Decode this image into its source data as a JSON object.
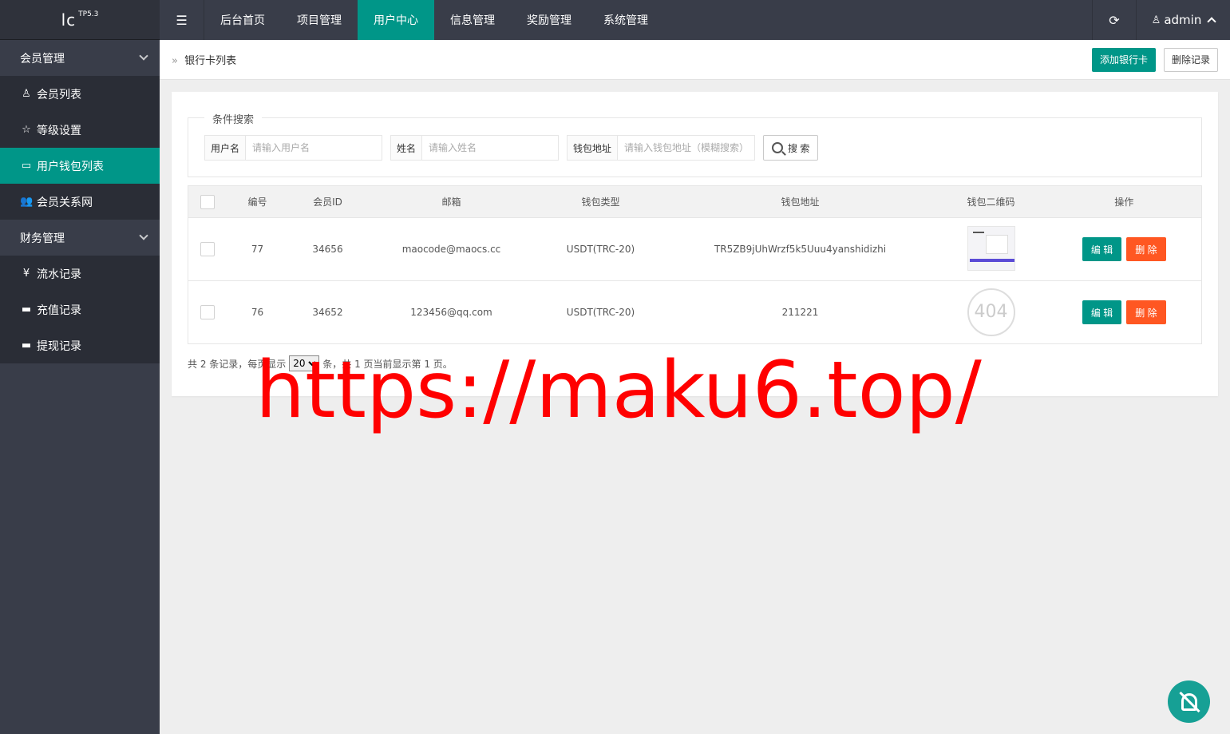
{
  "app": {
    "logo": "lc",
    "version": "TP5.3"
  },
  "sidebar": {
    "groups": [
      {
        "label": "会员管理",
        "items": [
          {
            "label": "会员列表",
            "icon": "user-icon",
            "glyph": "♙"
          },
          {
            "label": "等级设置",
            "icon": "star-icon",
            "glyph": "☆"
          },
          {
            "label": "用户钱包列表",
            "icon": "card-icon",
            "glyph": "▭"
          },
          {
            "label": "会员关系网",
            "icon": "users-icon",
            "glyph": "👥"
          }
        ]
      },
      {
        "label": "财务管理",
        "items": [
          {
            "label": "流水记录",
            "icon": "yen-icon",
            "glyph": "¥"
          },
          {
            "label": "充值记录",
            "icon": "paypal-icon",
            "glyph": "▬"
          },
          {
            "label": "提现记录",
            "icon": "wallet-icon",
            "glyph": "▬"
          }
        ]
      }
    ]
  },
  "topbar": {
    "menu_glyph": "☰",
    "tabs": [
      "后台首页",
      "项目管理",
      "用户中心",
      "信息管理",
      "奖励管理",
      "系统管理"
    ],
    "refresh_glyph": "⟳",
    "user_glyph": "♙",
    "username": "admin"
  },
  "breadcrumb": {
    "arrow": "»",
    "label": "银行卡列表"
  },
  "actions": {
    "add_label": "添加银行卡",
    "delete_log_label": "删除记录"
  },
  "search": {
    "legend": "条件搜索",
    "username_label": "用户名",
    "username_placeholder": "请输入用户名",
    "name_label": "姓名",
    "name_placeholder": "请输入姓名",
    "wallet_label": "钱包地址",
    "wallet_placeholder": "请输入钱包地址（模糊搜索）",
    "button_label": "搜 索"
  },
  "table": {
    "headers": [
      "编号",
      "会员ID",
      "邮箱",
      "钱包类型",
      "钱包地址",
      "钱包二维码",
      "操作"
    ],
    "rows": [
      {
        "id": "77",
        "member_id": "34656",
        "email": "maocode@maocs.cc",
        "type": "USDT(TRC-20)",
        "address": "TR5ZB9jUhWrzf5k5Uuu4yanshidizhi",
        "qr": "image"
      },
      {
        "id": "76",
        "member_id": "34652",
        "email": "123456@qq.com",
        "type": "USDT(TRC-20)",
        "address": "211221",
        "qr": "404"
      }
    ],
    "edit_label": "编 辑",
    "delete_label": "删 除"
  },
  "pager": {
    "prefix": "共 2 条记录，每页显示",
    "page_size": "20",
    "suffix": "条，共 1 页当前显示第 1 页。"
  },
  "watermark": "https://maku6.top/",
  "colors": {
    "sidebar": "#393d49",
    "accent": "#009688",
    "danger": "#ff5722",
    "watermark": "#ff0000"
  }
}
